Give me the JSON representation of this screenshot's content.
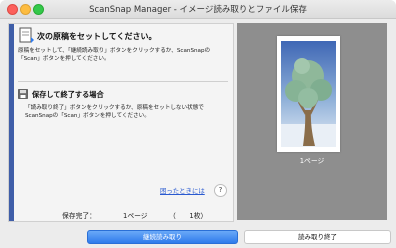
{
  "window": {
    "title": "ScanSnap Manager - イメージ読み取りとファイル保存"
  },
  "next_doc": {
    "heading": "次の原稿をセットしてください。",
    "body": "原稿をセットして、「継続読み取り」ボタンをクリックするか、ScanSnapの「Scan」ボタンを押してください。"
  },
  "save_finish": {
    "heading": "保存して終了する場合",
    "body": "「読み取り終了」ボタンをクリックするか、原稿をセットしない状態でScanSnapの「Scan」ボタンを押してください。"
  },
  "help": {
    "link": "困ったときには",
    "button": "?"
  },
  "status": {
    "label": "保存完了：",
    "pages": "1ページ",
    "sheets": "（　　1枚）"
  },
  "preview": {
    "page_label": "1ページ"
  },
  "buttons": {
    "continue": "継続読み取り",
    "finish": "読み取り終了"
  },
  "colors": {
    "accent": "#3f5ea8",
    "primary_button": "#2f7bec",
    "link": "#2a5ad0"
  }
}
